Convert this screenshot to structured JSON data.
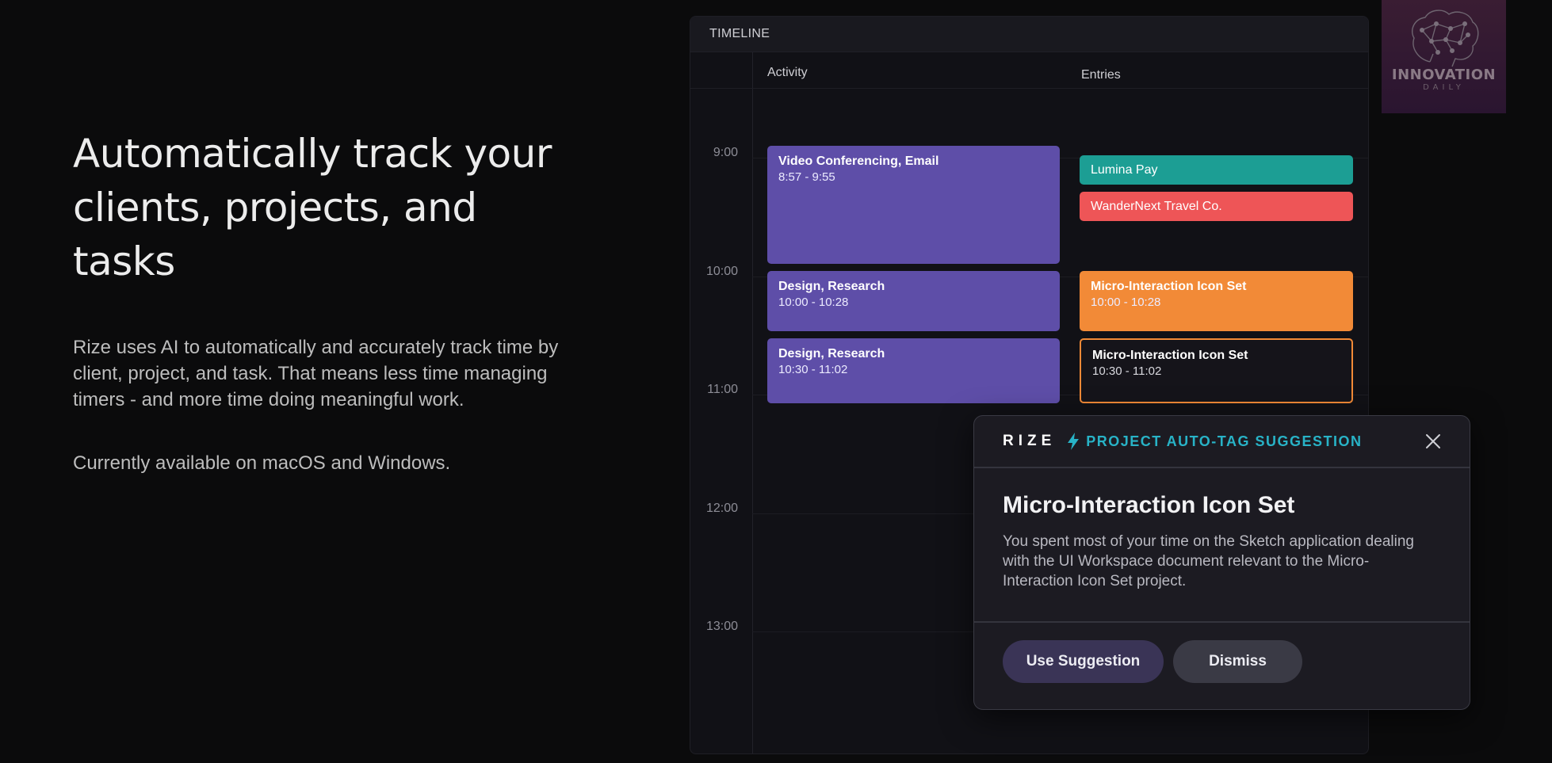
{
  "hero": {
    "headline_line1": "Automatically track your",
    "headline_line2": "clients, projects, and",
    "headline_line3": "tasks",
    "description": "Rize uses AI to automatically and accurately track time by client, project, and task. That means less time managing timers - and more time doing meaningful work.",
    "availability": "Currently available on macOS and Windows."
  },
  "timeline": {
    "title": "TIMELINE",
    "columns": {
      "activity": "Activity",
      "entries": "Entries"
    },
    "hours": [
      "9:00",
      "10:00",
      "11:00",
      "12:00",
      "13:00"
    ],
    "activity_blocks": [
      {
        "title": "Video Conferencing, Email",
        "time": "8:57 - 9:55"
      },
      {
        "title": "Design, Research",
        "time": "10:00 - 10:28"
      },
      {
        "title": "Design, Research",
        "time": "10:30 - 11:02"
      }
    ],
    "entries": [
      {
        "title": "Lumina Pay",
        "color": "#1c9e94"
      },
      {
        "title": "WanderNext Travel Co.",
        "color": "#ee5557"
      },
      {
        "title": "Micro-Interaction Icon Set",
        "time": "10:00 - 10:28",
        "color": "#f28a37"
      },
      {
        "title": "Micro-Interaction Icon Set",
        "time": "10:30 - 11:02",
        "color": "#f28a37"
      }
    ]
  },
  "logo": {
    "name": "INNOVATION",
    "subtitle": "DAILY"
  },
  "popup": {
    "brand": "RIZE",
    "tag_label": "PROJECT AUTO-TAG SUGGESTION",
    "title": "Micro-Interaction Icon Set",
    "description": "You spent most of your time on the Sketch application dealing with the UI Workspace document relevant to the Micro-Interaction Icon Set project.",
    "use_label": "Use Suggestion",
    "dismiss_label": "Dismiss",
    "accent_color": "#28b3c7"
  }
}
